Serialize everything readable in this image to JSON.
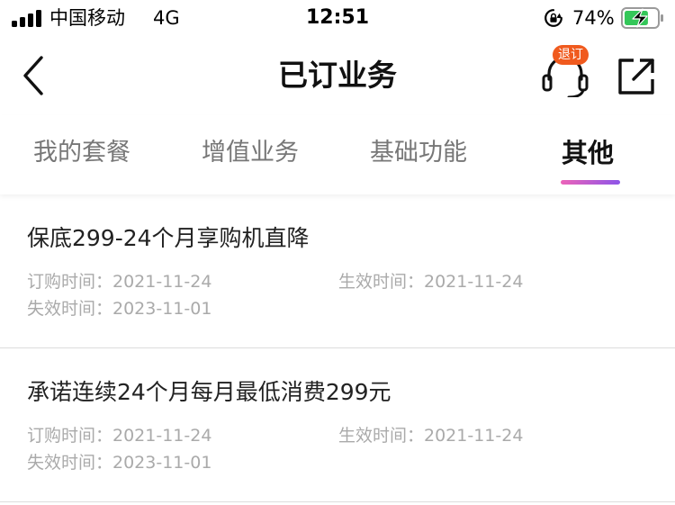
{
  "status_bar": {
    "carrier": "中国移动",
    "network": "4G",
    "time": "12:51",
    "battery_percent": "74%",
    "battery_level": 0.74,
    "battery_color": "#34c759"
  },
  "nav": {
    "title": "已订业务",
    "badge": "退订"
  },
  "tabs": [
    {
      "label": "我的套餐",
      "active": false
    },
    {
      "label": "增值业务",
      "active": false
    },
    {
      "label": "基础功能",
      "active": false
    },
    {
      "label": "其他",
      "active": true
    }
  ],
  "colors": {
    "badge": "#f05a1e",
    "indicator_start": "#ec63b8",
    "indicator_end": "#8d55e8"
  },
  "items": [
    {
      "title": "保底299-24个月享购机直降",
      "subscribe_time": "订购时间：2021-11-24",
      "effective_time": "生效时间：2021-11-24",
      "expire_time": "失效时间：2023-11-01"
    },
    {
      "title": "承诺连续24个月每月最低消费299元",
      "subscribe_time": "订购时间：2021-11-24",
      "effective_time": "生效时间：2021-11-24",
      "expire_time": "失效时间：2023-11-01"
    }
  ]
}
